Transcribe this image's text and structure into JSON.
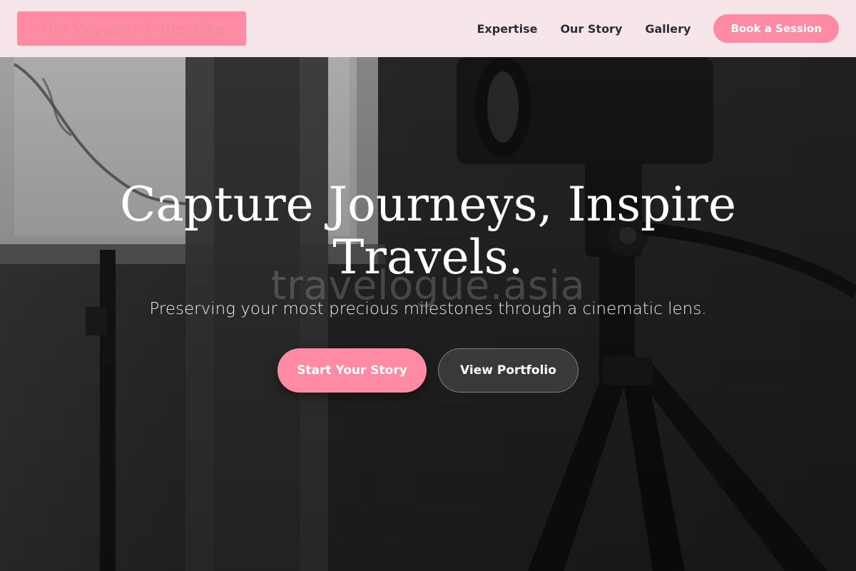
{
  "header": {
    "logo": "The Voyager Collective",
    "nav": [
      {
        "label": "Expertise"
      },
      {
        "label": "Our Story"
      },
      {
        "label": "Gallery"
      }
    ],
    "cta_label": "Book a Session"
  },
  "hero": {
    "title": "Capture Journeys, Inspire Travels.",
    "watermark": "travelogue.asia",
    "subtitle": "Preserving your most precious milestones through a cinematic lens.",
    "primary_cta": "Start Your Story",
    "secondary_cta": "View Portfolio",
    "background": "black-and-white photo of a camera on a tripod beside a window"
  },
  "colors": {
    "accent": "#ff8aa3",
    "header_bg": "#f6e6ea",
    "nav_text": "#2c2c34",
    "hero_text": "#ffffff"
  }
}
